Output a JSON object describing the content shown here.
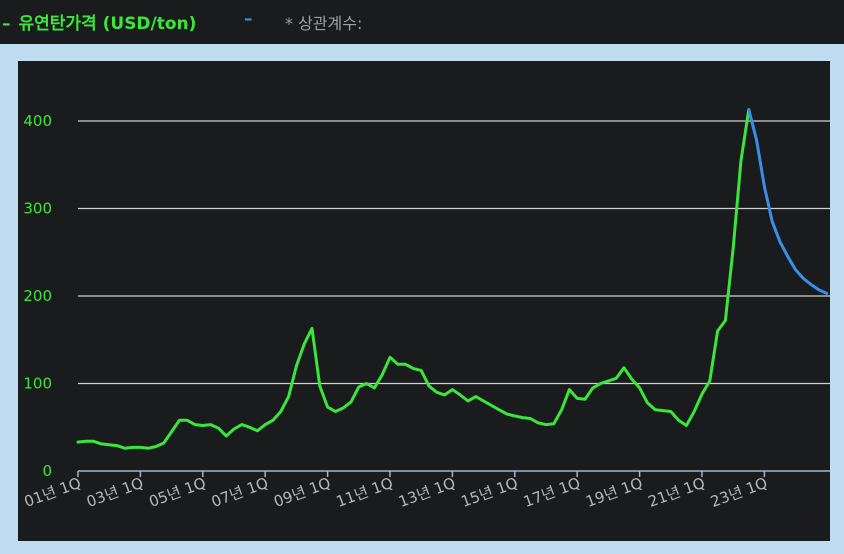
{
  "legend": {
    "series1_label": "유연탄가격 (USD/ton)",
    "series1_dash": "–",
    "series2_dash": "–",
    "note": "* 상관계수:"
  },
  "colors": {
    "actual": "#39e639",
    "forecast": "#3b8ee6",
    "grid": "#d0d0d0",
    "ytick": "#39e639",
    "xtick": "#b8b8b8",
    "background": "#1a1b1d",
    "frame": "#bfdcf0"
  },
  "chart_data": {
    "type": "line",
    "title": "",
    "xlabel": "",
    "ylabel": "",
    "ylim": [
      0,
      450
    ],
    "yticks": [
      0,
      100,
      200,
      300,
      400
    ],
    "grid": true,
    "x_start": "01년 1Q",
    "x_end": "26년 4Q",
    "xtick_labels": [
      "01년 1Q",
      "03년 1Q",
      "05년 1Q",
      "07년 1Q",
      "09년 1Q",
      "11년 1Q",
      "13년 1Q",
      "15년 1Q",
      "17년 1Q",
      "19년 1Q",
      "21년 1Q",
      "23년 1Q"
    ],
    "series": [
      {
        "role": "actual",
        "values": [
          33,
          34,
          34,
          31,
          30,
          29,
          26,
          27,
          27,
          26,
          28,
          32,
          45,
          58,
          58,
          53,
          52,
          53,
          49,
          40,
          48,
          53,
          50,
          46,
          53,
          58,
          68,
          85,
          120,
          145,
          163,
          97,
          73,
          68,
          72,
          79,
          96,
          100,
          95,
          110,
          130,
          122,
          122,
          117,
          115,
          97,
          90,
          87,
          93,
          87,
          80,
          85,
          80,
          75,
          70,
          65,
          63,
          61,
          60,
          55,
          53,
          54,
          70,
          93,
          83,
          82,
          95,
          100,
          103,
          106,
          118,
          105,
          95,
          78,
          70,
          69,
          68,
          58,
          52,
          68,
          88,
          103,
          160,
          172,
          255,
          355,
          413
        ]
      },
      {
        "role": "forecast",
        "start_index": 86,
        "values": [
          413,
          378,
          325,
          285,
          262,
          245,
          230,
          220,
          213,
          207,
          203
        ]
      }
    ]
  }
}
